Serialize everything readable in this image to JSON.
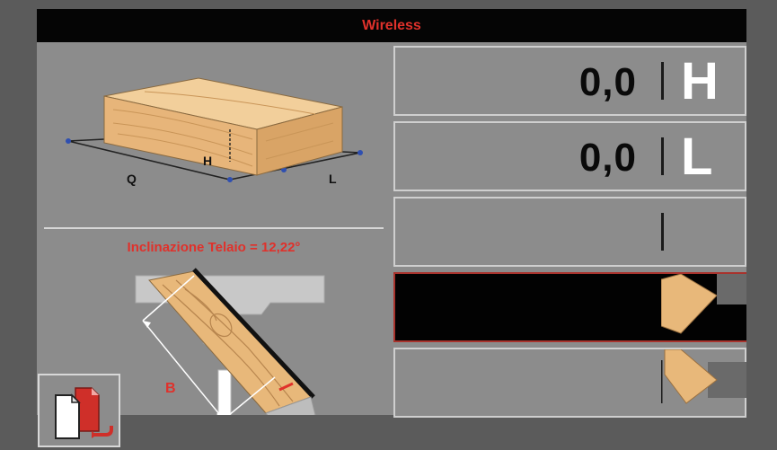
{
  "titlebar": {
    "title": "Wireless"
  },
  "diagram_top": {
    "label_h": "H",
    "label_q": "Q",
    "label_l": "L"
  },
  "diagram_bottom": {
    "inclination_text": "Inclinazione Telaio = 12,22°",
    "label_b": "B"
  },
  "rows": [
    {
      "value": "0,0",
      "letter": "H"
    },
    {
      "value": "0,0",
      "letter": "L"
    },
    {
      "value": "",
      "letter": ""
    },
    {
      "value": "",
      "letter": ""
    },
    {
      "value": "",
      "letter": ""
    }
  ],
  "colors": {
    "accent": "#e0312b",
    "wood": "#e8b87a",
    "panel": "#8c8c8c",
    "titlebar": "#050505"
  },
  "icons": {
    "copy": "copy-documents-return-icon",
    "profile_corner": "wood-corner-profile-icon"
  }
}
